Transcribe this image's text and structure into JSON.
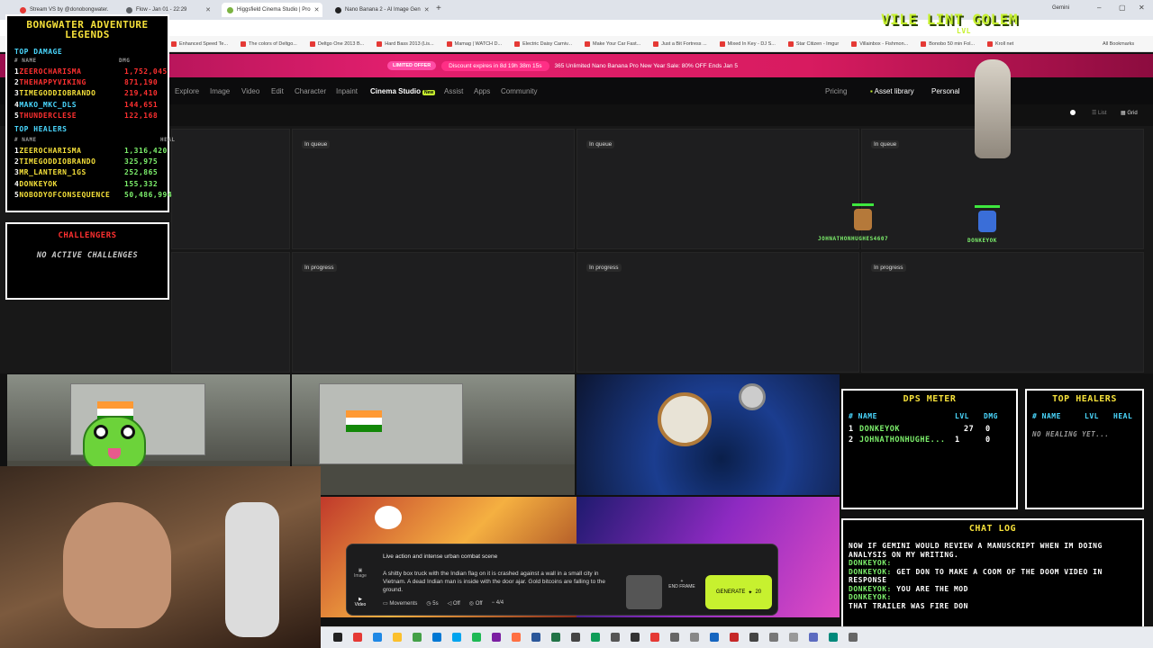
{
  "browser": {
    "tabs": [
      {
        "label": "Stream VS by @donobongwater.",
        "color": "#e53935",
        "active": false
      },
      {
        "label": "Flow - Jan 01 - 22:29",
        "color": "#5f6368",
        "active": false
      },
      {
        "label": "Higgsfield Cinema Studio | Pro",
        "color": "#7cb342",
        "active": true
      },
      {
        "label": "Nano Banana 2 - AI Image Gen",
        "color": "#222222",
        "active": false
      }
    ],
    "gemini_label": "Gemini",
    "bookmarks": [
      "Enhanced Speed Te...",
      "The colors of Deltgo...",
      "Deltgo One 2013 B...",
      "Hard Bass 2013 (Lis...",
      "Mamag | WATCH D...",
      "Electric Daisy Carniv...",
      "Make Your Car Fast...",
      "Just a Bit Fortress ...",
      "Mixed In Key - DJ S...",
      "Star Citizen - Imgur",
      "Villainbox - Fishmon...",
      "Bonobo 50 min Fol...",
      "Kroll net"
    ],
    "all_bookmarks": "All Bookmarks"
  },
  "promo": {
    "limited": "LIMITED OFFER",
    "expires": "Discount expires in 8d 19h 38m 15s",
    "text": "365 Unlimited Nano Banana Pro New Year Sale: 80% OFF Ends Jan 5"
  },
  "nav": {
    "items": [
      "Explore",
      "Image",
      "Video",
      "Edit",
      "Character",
      "Inpaint",
      "Cinema Studio",
      "Assist",
      "Apps",
      "Community"
    ],
    "new_badge": "New",
    "pricing": "Pricing",
    "asset_library": "Asset library",
    "personal": "Personal",
    "view_list": "List",
    "view_grid": "Grid"
  },
  "grid": {
    "row1": [
      "In queue",
      "In queue",
      "In queue"
    ],
    "row2": [
      "In progress",
      "In progress",
      "In progress"
    ]
  },
  "prompt": {
    "title": "Live action and intense urban combat scene",
    "body": "A shitty box truck with the Indian flag on it is crashed against a wall in a small city in Vietnam. A dead Indian man is inside with the door ajar. Gold bitcoins are falling to the ground.",
    "chips": [
      "Movements",
      "5s",
      "Off",
      "Off",
      "4/4"
    ],
    "end_frame": "END FRAME",
    "generate": "GENERATE",
    "generate_count": "20",
    "side_image": "Image",
    "side_video": "Video"
  },
  "overlay": {
    "title": "BONGWATER ADVENTURE LEGENDS",
    "top_damage": "TOP DAMAGE",
    "col_name": "# NAME",
    "col_dmg": "DMG",
    "damage": [
      {
        "rank": "1",
        "name": "ZEEROCHARISMA",
        "value": "1,752,045"
      },
      {
        "rank": "2",
        "name": "THEHAPPYVIKING",
        "value": "871,190"
      },
      {
        "rank": "3",
        "name": "TIMEGODDIOBRANDO",
        "value": "219,410"
      },
      {
        "rank": "4",
        "name": "MAKO_MKC_DLS",
        "value": "144,651"
      },
      {
        "rank": "5",
        "name": "THUNDERCLESE",
        "value": "122,168"
      }
    ],
    "top_healers": "TOP HEALERS",
    "col_heal": "HEAL",
    "healers": [
      {
        "rank": "1",
        "name": "ZEEROCHARISMA",
        "value": "1,316,420"
      },
      {
        "rank": "2",
        "name": "TIMEGODDIOBRANDO",
        "value": "325,975"
      },
      {
        "rank": "3",
        "name": "MR_LANTERN_1GS",
        "value": "252,865"
      },
      {
        "rank": "4",
        "name": "DONKEYOK",
        "value": "155,332"
      },
      {
        "rank": "5",
        "name": "NOBODYOFCONSEQUENCE",
        "value": "50,486,994"
      }
    ],
    "challengers": "CHALLENGERS",
    "no_challenges": "NO ACTIVE CHALLENGES",
    "boss_name": "VILE LINT GOLEM",
    "boss_level": "LVL",
    "players": [
      "JOHNATHONHUGHES4607",
      "DONKEYOK"
    ],
    "dps_title": "DPS METER",
    "dps_cols": [
      "# NAME",
      "LVL",
      "DMG"
    ],
    "dps_rows": [
      {
        "rank": "1",
        "name": "DONKEYOK",
        "lvl": "27",
        "dmg": "0"
      },
      {
        "rank": "2",
        "name": "JOHNATHONHUGHE...",
        "lvl": "1",
        "dmg": "0"
      }
    ],
    "healers2_title": "TOP HEALERS",
    "healers2_cols": [
      "# NAME",
      "LVL",
      "HEAL"
    ],
    "no_healing": "NO HEALING YET...",
    "chat_title": "CHAT LOG",
    "chat": [
      {
        "user": "",
        "text": "NOW IF GEMINI WOULD REVIEW A MANUSCRIPT WHEN IM DOING ANALYSIS ON MY WRITING.",
        "color": "#ffffff"
      },
      {
        "user": "DONKEYOK:",
        "text": "",
        "color": "#7df06c"
      },
      {
        "user": "DONKEYOK:",
        "text": "GET DON TO MAKE A COOM OF THE DOOM VIDEO IN RESPONSE",
        "color": "#7df06c"
      },
      {
        "user": "DONKEYOK:",
        "text": "YOU ARE THE MOD",
        "color": "#7df06c"
      },
      {
        "user": "DONKEYOK:",
        "text": "",
        "color": "#7df06c"
      },
      {
        "user": "",
        "text": "THAT TRAILER WAS FIRE DON",
        "color": "#ffffff"
      }
    ]
  },
  "colors": {
    "accent_green": "#c7f12f",
    "promo_pink": "#e31f6e",
    "overlay_yellow": "#f5e03a",
    "overlay_red": "#ff3030",
    "overlay_green": "#7df06c",
    "overlay_cyan": "#4ad8ff"
  }
}
